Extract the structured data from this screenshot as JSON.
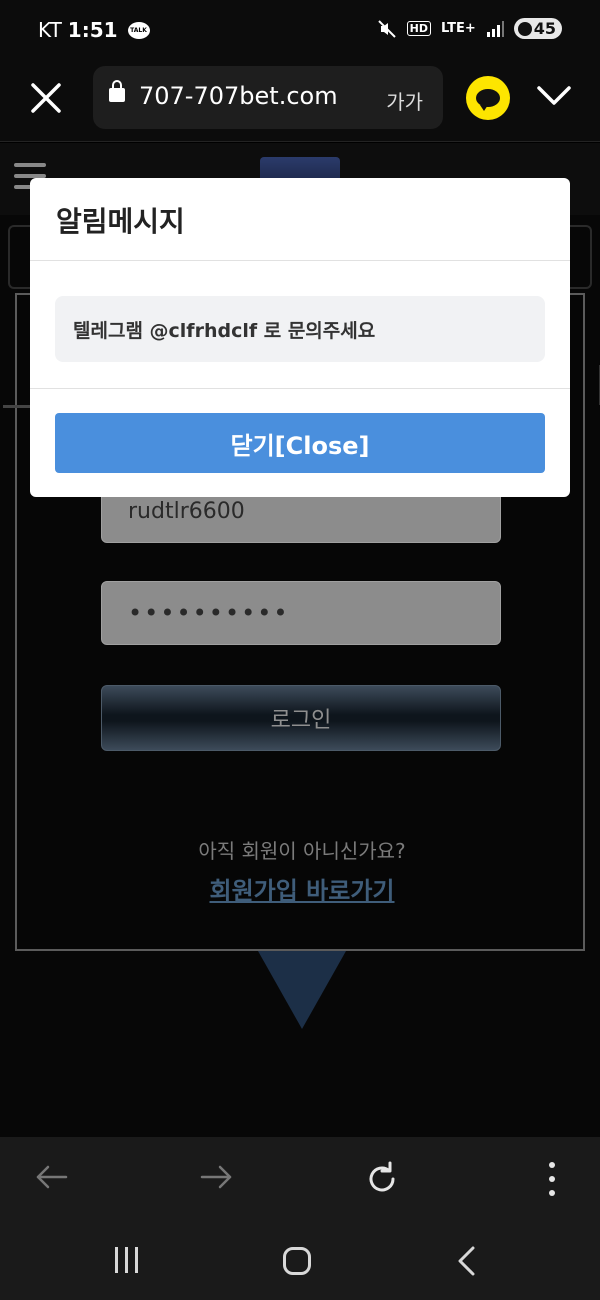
{
  "status_bar": {
    "carrier": "KT",
    "time": "1:51",
    "talk_badge": "TALK",
    "hd_badge": "HD",
    "network": "LTE+",
    "battery": "45"
  },
  "browser": {
    "url": "707-707bet.com",
    "text_size_label": "가가"
  },
  "login": {
    "username_value": "rudtlr6600",
    "password_mask": "••••••••••",
    "login_label": "로그인",
    "signup_question": "아직 회원이 아니신가요?",
    "signup_link": "회원가입 바로가기"
  },
  "modal": {
    "title": "알림메시지",
    "message": "텔레그램 @clfrhdclf 로 문의주세요",
    "close_label": "닫기[Close]",
    "button_color": "#4a8fdd"
  },
  "colors": {
    "kakao_yellow": "#fde500",
    "page_background": "#000000",
    "toolbar_background": "#1a1a1a"
  }
}
